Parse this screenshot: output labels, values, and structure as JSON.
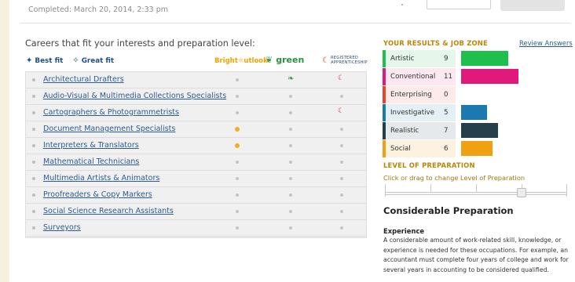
{
  "header": {
    "completed_text": "Completed: March 20, 2014, 2:33 pm"
  },
  "careers": {
    "heading": "Careers that fit your interests and preparation level:",
    "best_fit_label": "Best fit",
    "great_fit_label": "Great fit",
    "bright_outlook_label": "Bright",
    "bright_outlook_label2": "utlook",
    "green_label": "green",
    "apprenticeship_line1": "REGISTERED",
    "apprenticeship_line2": "APPRENTICESHIP",
    "occupations": [
      {
        "name": "Architectural Drafters",
        "bright": false,
        "green": true,
        "apprentice": true
      },
      {
        "name": "Audio-Visual & Multimedia Collections Specialists",
        "bright": false,
        "green": false,
        "apprentice": false
      },
      {
        "name": "Cartographers & Photogrammetrists",
        "bright": false,
        "green": false,
        "apprentice": true
      },
      {
        "name": "Document Management Specialists",
        "bright": true,
        "green": false,
        "apprentice": false
      },
      {
        "name": "Interpreters & Translators",
        "bright": true,
        "green": false,
        "apprentice": false
      },
      {
        "name": "Mathematical Technicians",
        "bright": false,
        "green": false,
        "apprentice": false
      },
      {
        "name": "Multimedia Artists & Animators",
        "bright": false,
        "green": false,
        "apprentice": false
      },
      {
        "name": "Proofreaders & Copy Markers",
        "bright": false,
        "green": false,
        "apprentice": false
      },
      {
        "name": "Social Science Research Assistants",
        "bright": false,
        "green": false,
        "apprentice": false
      },
      {
        "name": "Surveyors",
        "bright": false,
        "green": false,
        "apprentice": false
      }
    ]
  },
  "results": {
    "title": "YOUR RESULTS & JOB ZONE",
    "review_link": "Review Answers",
    "max_score": 12,
    "interests": [
      {
        "name": "Artistic",
        "score": 9,
        "color": "#1fbf4b",
        "bg": "#e6f6ea",
        "edge": "#1fbf4b"
      },
      {
        "name": "Conventional",
        "score": 11,
        "color": "#e0197a",
        "bg": "#fde8f1",
        "edge": "#e0197a"
      },
      {
        "name": "Enterprising",
        "score": 0,
        "color": "#e8432e",
        "bg": "#fdebe7",
        "edge": "#e8432e"
      },
      {
        "name": "Investigative",
        "score": 5,
        "color": "#1c78b0",
        "bg": "#e4eff6",
        "edge": "#1c78b0"
      },
      {
        "name": "Realistic",
        "score": 7,
        "color": "#253f4b",
        "bg": "#e6e9eb",
        "edge": "#253f4b"
      },
      {
        "name": "Social",
        "score": 6,
        "color": "#efa112",
        "bg": "#fdf2df",
        "edge": "#efa112"
      }
    ]
  },
  "preparation": {
    "title": "LEVEL OF PREPARATION",
    "hint": "Click or drag to change Level of Preparation",
    "selected_level": 4,
    "total_levels": 5,
    "level_name": "Considerable Preparation",
    "experience_title": "Experience",
    "experience_text": "A considerable amount of work-related skill, knowledge, or experience is needed for these occupations. For example, an accountant must complete four years of college and work for several years in accounting to be considered qualified."
  }
}
